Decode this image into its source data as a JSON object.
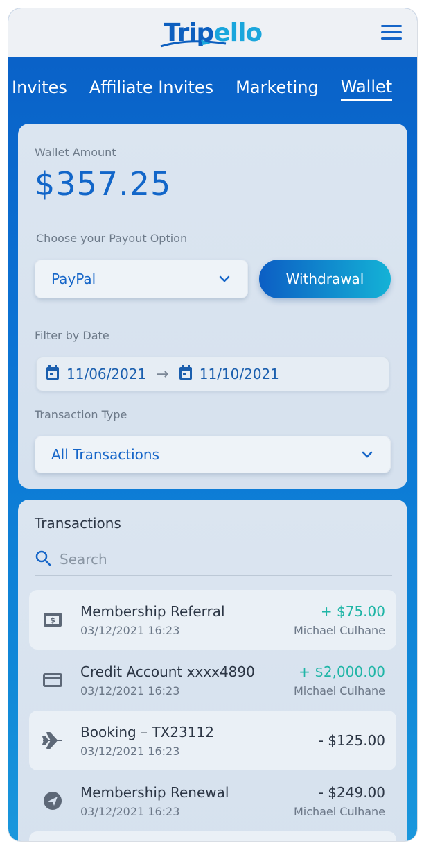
{
  "app": {
    "logo_part1": "Trip",
    "logo_part2": "ello"
  },
  "tabs": [
    {
      "label": "Invites",
      "active": false
    },
    {
      "label": "Affiliate Invites",
      "active": false
    },
    {
      "label": "Marketing",
      "active": false
    },
    {
      "label": "Wallet",
      "active": true
    }
  ],
  "wallet": {
    "amount_label": "Wallet Amount",
    "amount": "$357.25",
    "payout_label": "Choose your Payout Option",
    "payout_selected": "PayPal",
    "withdraw_label": "Withdrawal"
  },
  "filters": {
    "date_label": "Filter by Date",
    "date_from": "11/06/2021",
    "date_to": "11/10/2021",
    "type_label": "Transaction Type",
    "type_selected": "All Transactions"
  },
  "transactions": {
    "heading": "Transactions",
    "search_placeholder": "Search",
    "items": [
      {
        "icon": "dollar-icon",
        "title": "Membership Referral",
        "date": "03/12/2021 16:23",
        "amount": "+ $75.00",
        "by": "Michael Culhane",
        "positive": true
      },
      {
        "icon": "credit-card-icon",
        "title": "Credit Account xxxx4890",
        "date": "03/12/2021 16:23",
        "amount": "+ $2,000.00",
        "by": "Michael Culhane",
        "positive": true
      },
      {
        "icon": "airplane-icon",
        "title": "Booking – TX23112",
        "date": "03/12/2021 16:23",
        "amount": "- $125.00",
        "by": "",
        "positive": false
      },
      {
        "icon": "renewal-icon",
        "title": "Membership Renewal",
        "date": "03/12/2021 16:23",
        "amount": "- $249.00",
        "by": "Michael Culhane",
        "positive": false
      }
    ]
  },
  "colors": {
    "primary": "#1266c9",
    "positive": "#1fb5a6",
    "background_blue": "#0b73d4"
  }
}
